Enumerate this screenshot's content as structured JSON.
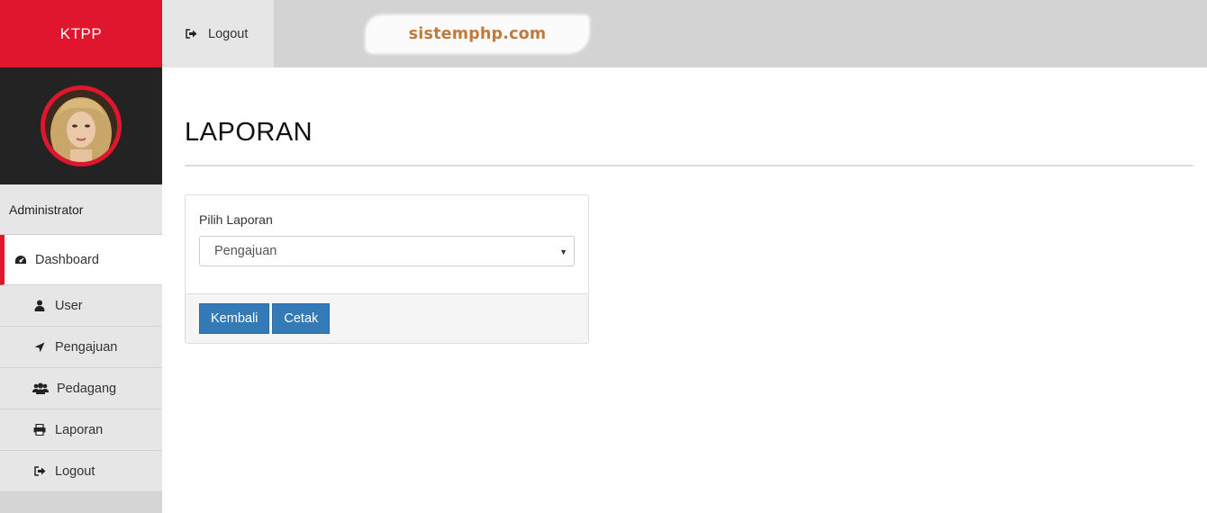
{
  "sidebar": {
    "brand": "KTPP",
    "role": "Administrator",
    "items": [
      {
        "label": "Dashboard",
        "icon": "dashboard-icon"
      },
      {
        "label": "User",
        "icon": "user-icon"
      },
      {
        "label": "Pengajuan",
        "icon": "location-arrow-icon"
      },
      {
        "label": "Pedagang",
        "icon": "users-icon"
      },
      {
        "label": "Laporan",
        "icon": "print-icon"
      },
      {
        "label": "Logout",
        "icon": "sign-out-icon"
      }
    ]
  },
  "topbar": {
    "logout_label": "Logout",
    "watermark": "sistemphp.com"
  },
  "main": {
    "title": "LAPORAN",
    "form": {
      "label": "Pilih Laporan",
      "selected": "Pengajuan"
    },
    "buttons": {
      "back": "Kembali",
      "print": "Cetak"
    }
  },
  "colors": {
    "accent": "#e0162e",
    "primary_button": "#337ab7",
    "sidebar_dark": "#232323",
    "watermark_text": "#c07a3c"
  }
}
